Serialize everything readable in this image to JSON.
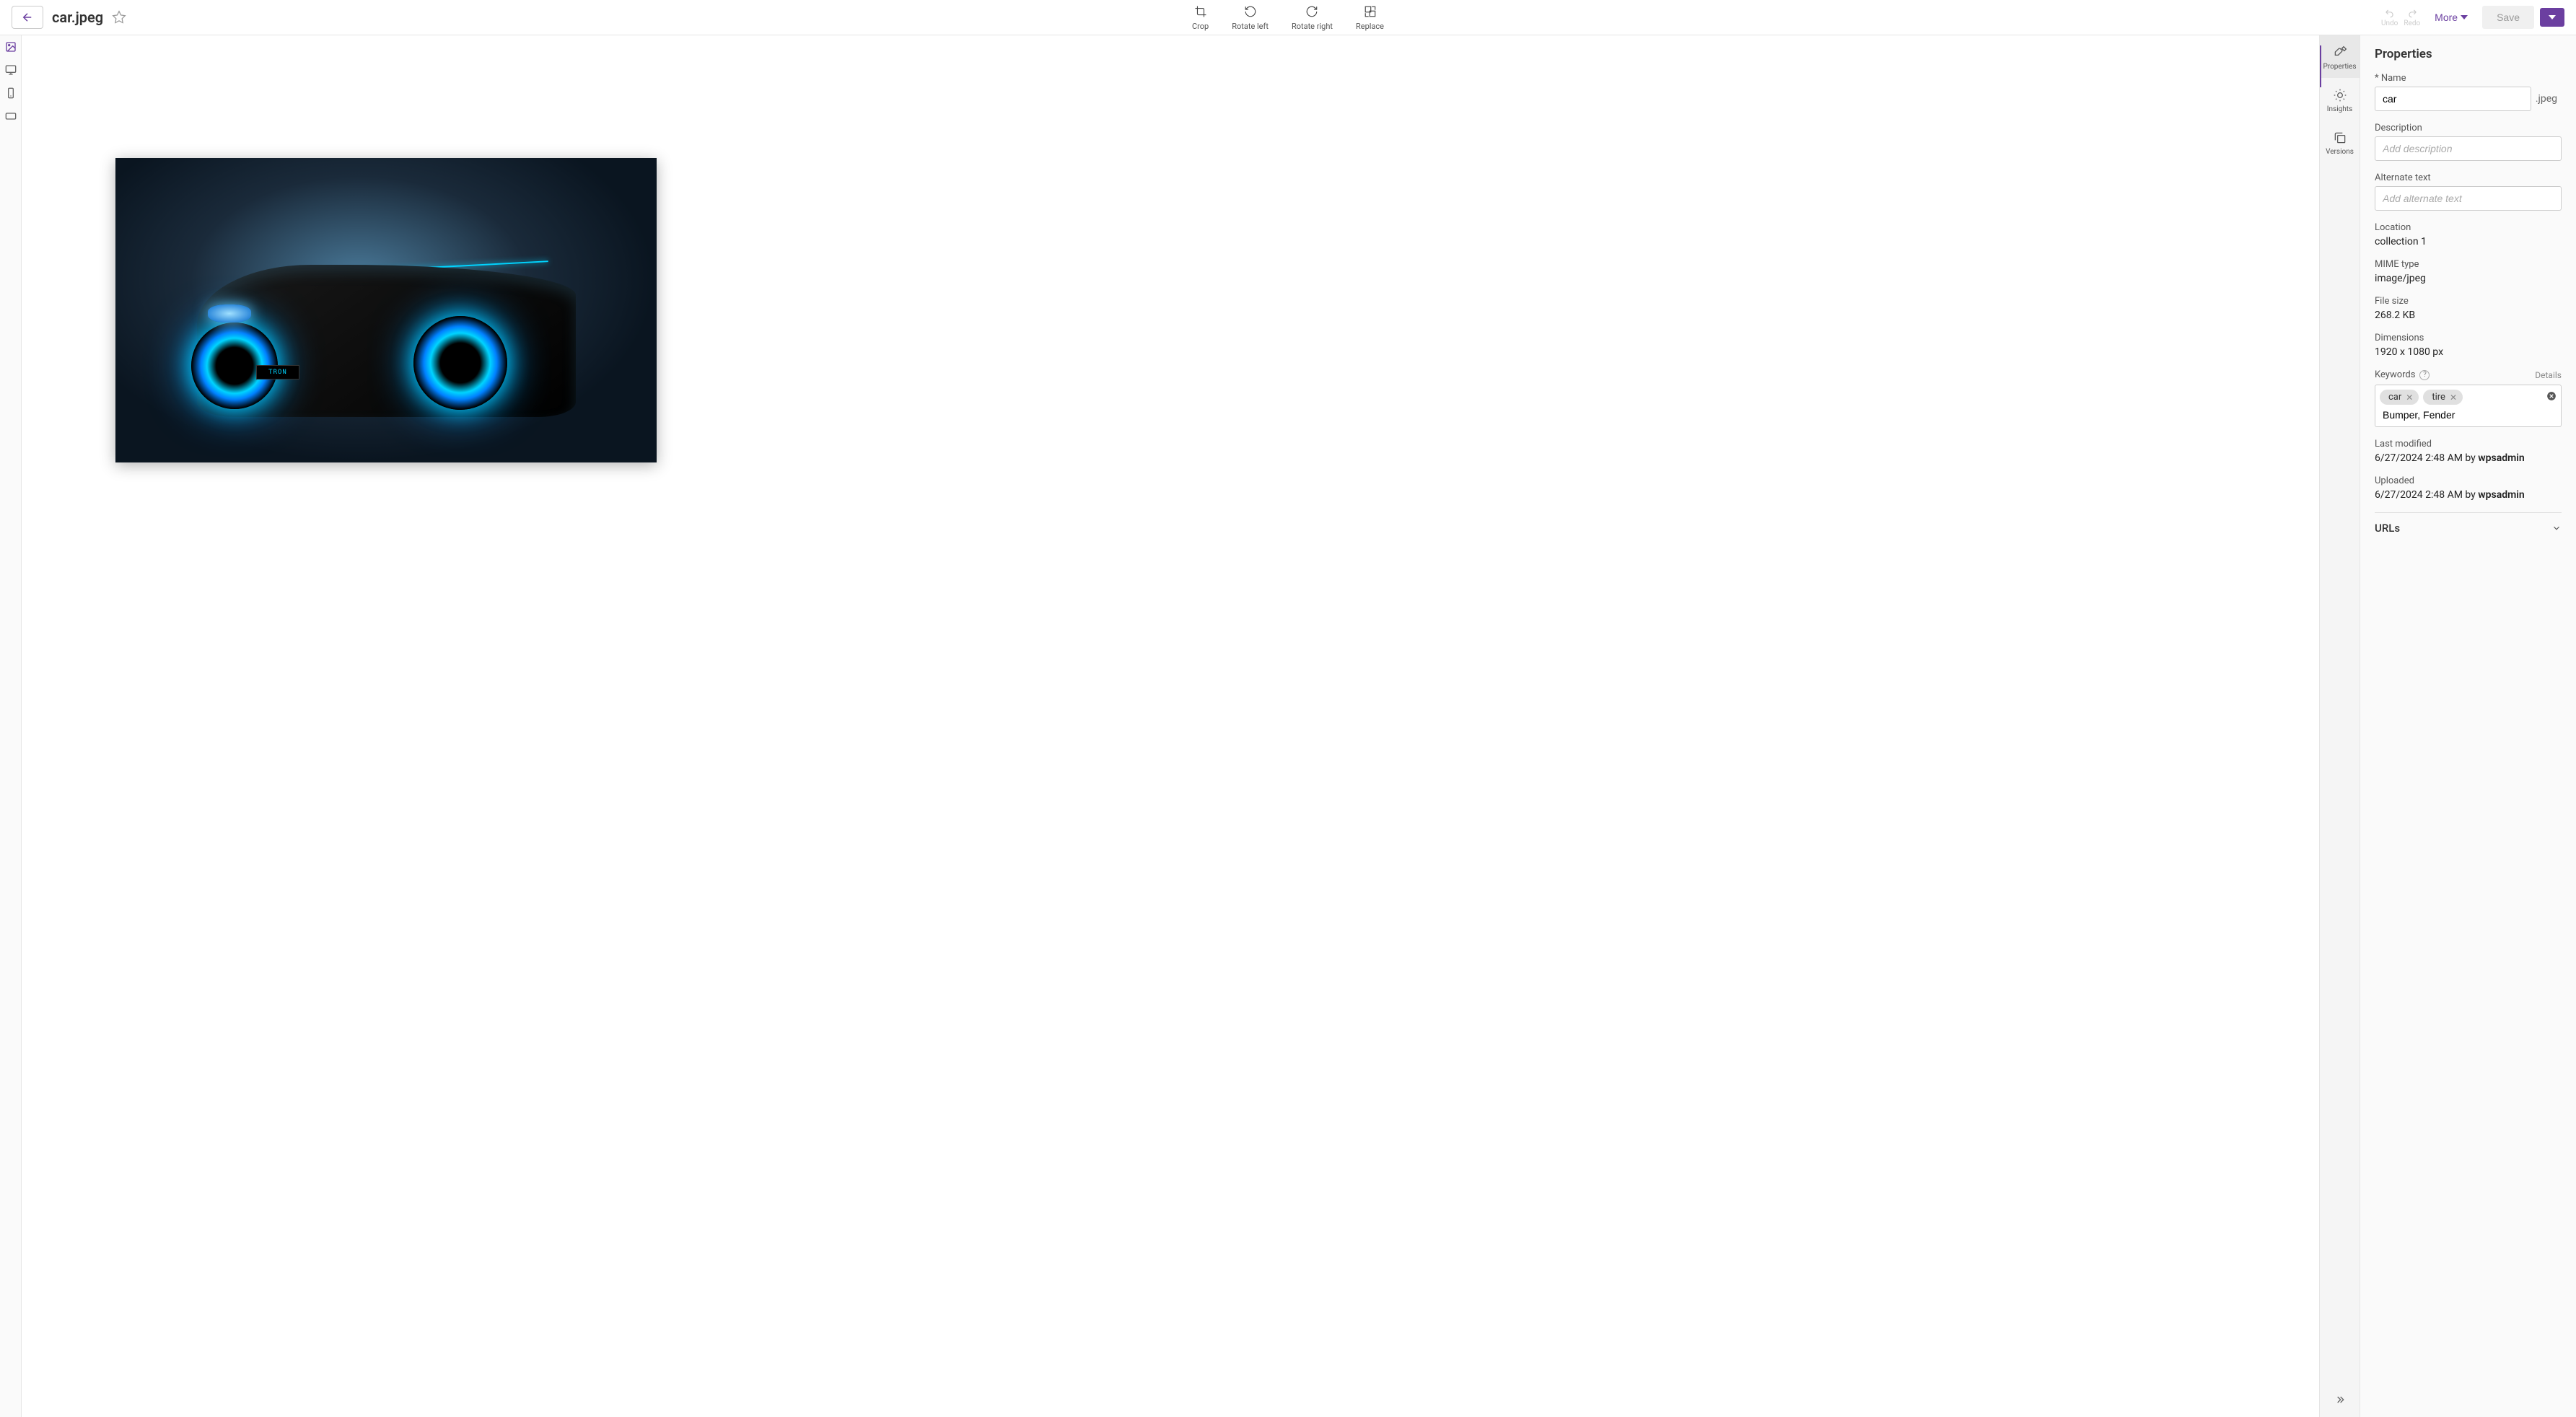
{
  "header": {
    "filename": "car.jpeg",
    "toolbar": {
      "crop": "Crop",
      "rotate_left": "Rotate left",
      "rotate_right": "Rotate right",
      "replace": "Replace"
    },
    "undo": "Undo",
    "redo": "Redo",
    "more": "More",
    "save": "Save"
  },
  "right_rail": {
    "properties": "Properties",
    "insights": "Insights",
    "versions": "Versions"
  },
  "panel": {
    "title": "Properties",
    "name_label": "* Name",
    "name_value": "car",
    "name_ext": ".jpeg",
    "description_label": "Description",
    "description_placeholder": "Add description",
    "alt_label": "Alternate text",
    "alt_placeholder": "Add alternate text",
    "location_label": "Location",
    "location_value": "collection 1",
    "mime_label": "MIME type",
    "mime_value": "image/jpeg",
    "filesize_label": "File size",
    "filesize_value": "268.2 KB",
    "dimensions_label": "Dimensions",
    "dimensions_value": "1920 x 1080 px",
    "keywords_label": "Keywords",
    "keywords_details": "Details",
    "keywords_tags": [
      "car",
      "tire"
    ],
    "keywords_input": "Bumper, Fender",
    "lastmod_label": "Last modified",
    "lastmod_time": "6/27/2024 2:48 AM by ",
    "lastmod_user": "wpsadmin",
    "uploaded_label": "Uploaded",
    "uploaded_time": "6/27/2024 2:48 AM by ",
    "uploaded_user": "wpsadmin",
    "urls_label": "URLs"
  },
  "image": {
    "plate": "TRON"
  }
}
